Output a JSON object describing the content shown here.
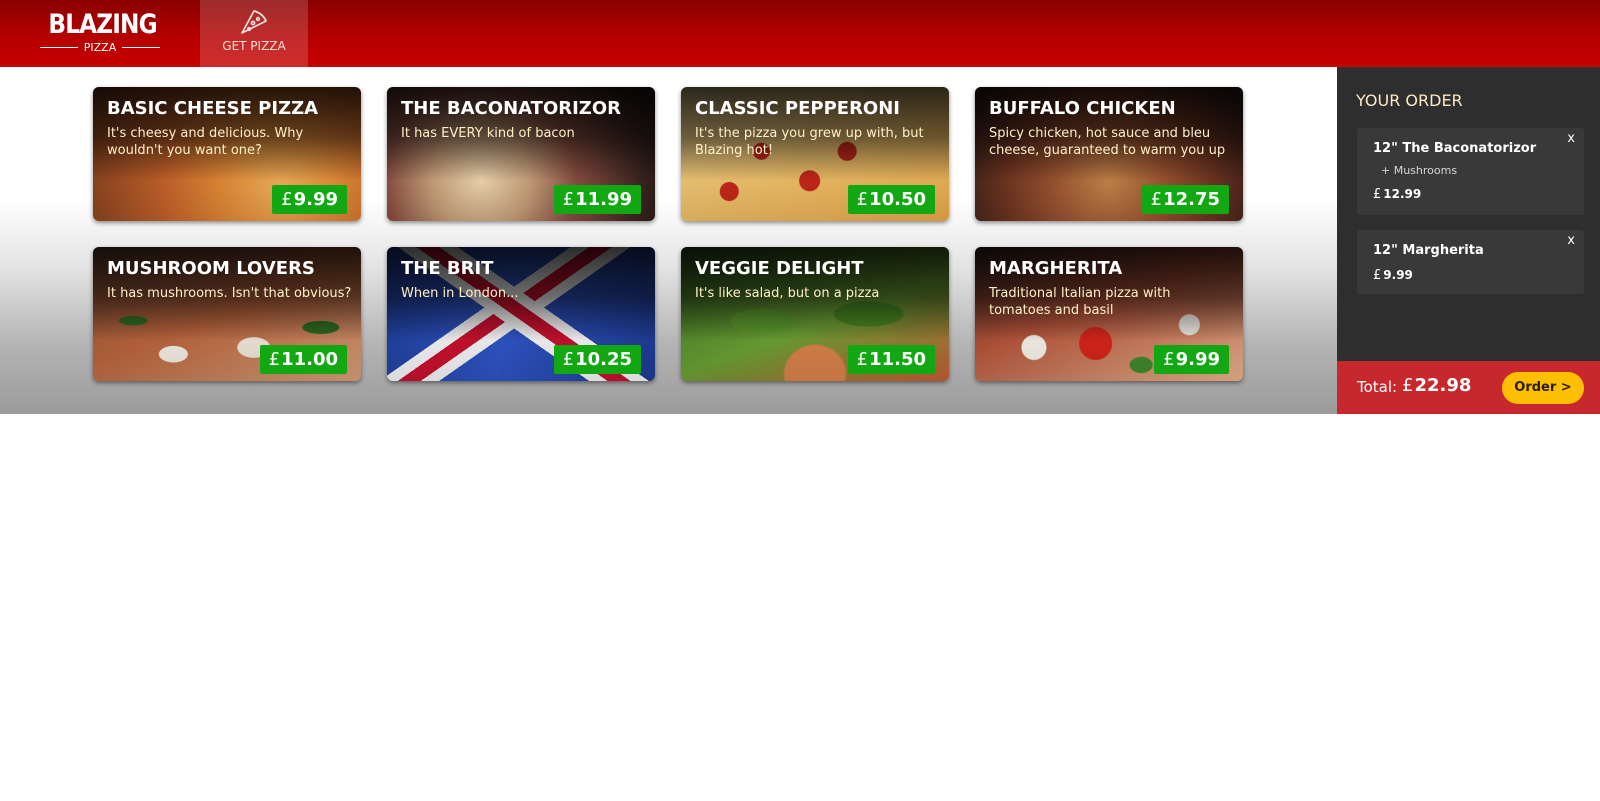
{
  "brand": {
    "name": "BLAZING",
    "sub": "PIZZA"
  },
  "nav": {
    "tab_label": "GET PIZZA",
    "tab_icon": "pizza-slice-icon"
  },
  "currency": "£",
  "pizzas": [
    {
      "title": "BASIC CHEESE PIZZA",
      "desc": "It's cheesy and delicious. Why wouldn't you want one?",
      "price": "9.99"
    },
    {
      "title": "THE BACONATORIZOR",
      "desc": "It has EVERY kind of bacon",
      "price": "11.99"
    },
    {
      "title": "CLASSIC PEPPERONI",
      "desc": "It's the pizza you grew up with, but Blazing hot!",
      "price": "10.50"
    },
    {
      "title": "BUFFALO CHICKEN",
      "desc": "Spicy chicken, hot sauce and bleu cheese, guaranteed to warm you up",
      "price": "12.75"
    },
    {
      "title": "MUSHROOM LOVERS",
      "desc": "It has mushrooms. Isn't that obvious?",
      "price": "11.00"
    },
    {
      "title": "THE BRIT",
      "desc": "When in London...",
      "price": "10.25"
    },
    {
      "title": "VEGGIE DELIGHT",
      "desc": "It's like salad, but on a pizza",
      "price": "11.50"
    },
    {
      "title": "MARGHERITA",
      "desc": "Traditional Italian pizza with tomatoes and basil",
      "price": "9.99"
    }
  ],
  "order": {
    "title": "YOUR ORDER",
    "items": [
      {
        "name": "12\" The Baconatorizor",
        "topping": "+ Mushrooms",
        "price": "12.99",
        "remove": "x"
      },
      {
        "name": "12\" Margherita",
        "price": "9.99",
        "remove": "x"
      }
    ],
    "total_label": "Total:",
    "total": "22.98",
    "button": "Order >"
  },
  "colors": {
    "header_red": "#b50000",
    "price_green": "#13a813",
    "sidebar_bg": "#2e2e2e",
    "total_bar": "#c6282d",
    "order_button": "#fcbf02",
    "accent_cream": "#fce8c4"
  }
}
